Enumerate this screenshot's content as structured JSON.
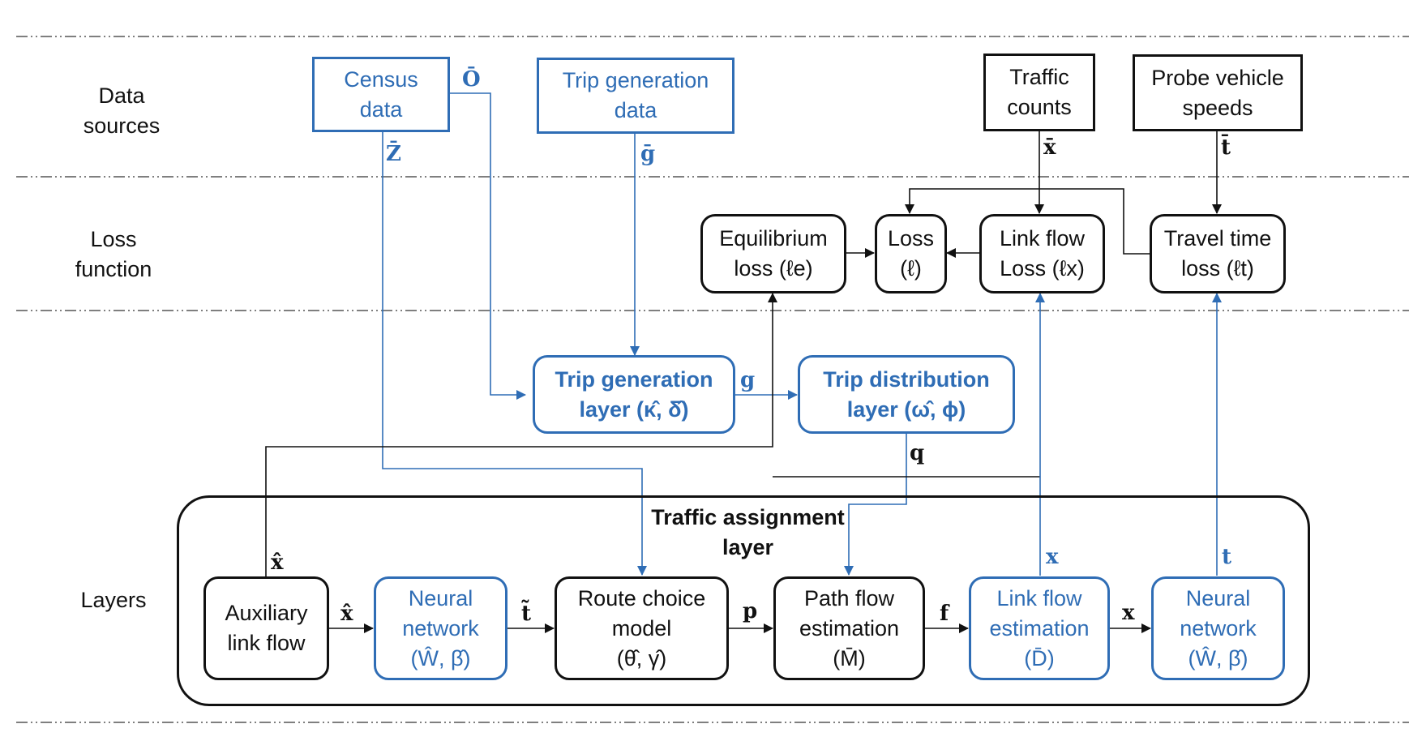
{
  "rows": [
    {
      "id": "data-sources",
      "label": "Data\nsources"
    },
    {
      "id": "loss-function",
      "label": "Loss\nfunction"
    },
    {
      "id": "layers",
      "label": "Layers"
    }
  ],
  "data_sources": {
    "census": "Census\ndata",
    "trip_generation_data": "Trip generation\ndata",
    "traffic_counts": "Traffic\ncounts",
    "probe_vehicle_speeds": "Probe vehicle\nspeeds"
  },
  "loss": {
    "equilibrium": "Equilibrium\nloss (ℓe)",
    "loss": "Loss\n(ℓ)",
    "link_flow": "Link flow\nLoss (ℓx)",
    "travel_time": "Travel time\nloss (ℓt)"
  },
  "upper_layers": {
    "trip_generation": "Trip generation\nlayer (κ̂, δ̂)",
    "trip_distribution": "Trip distribution\nlayer (ω̂, ϕ)"
  },
  "assignment": {
    "title": "Traffic assignment\nlayer",
    "auxiliary": "Auxiliary\nlink flow",
    "neural_network_1": "Neural\nnetwork\n(Ŵ, β̂)",
    "route_choice": "Route choice\nmodel\n(θ̂, γ̂)",
    "path_flow": "Path flow\nestimation\n(M̄)",
    "link_flow_est": "Link flow\nestimation\n(D̄)",
    "neural_network_2": "Neural\nnetwork\n(Ŵ, β̂)"
  },
  "edge_labels": {
    "o_bar": "Ō",
    "z_bar": "Z̄",
    "g_bar": "ḡ",
    "x_bar": "x̄",
    "t_bar": "t̄",
    "g": "g",
    "q": "q",
    "x_hat_up": "x̂",
    "x_hat": "x̂",
    "t_tilde": "t̃",
    "p": "p",
    "f": "f",
    "x_up": "x",
    "x": "x",
    "t_up": "t"
  },
  "colors": {
    "blue": "#2f6db5",
    "black": "#111111"
  }
}
